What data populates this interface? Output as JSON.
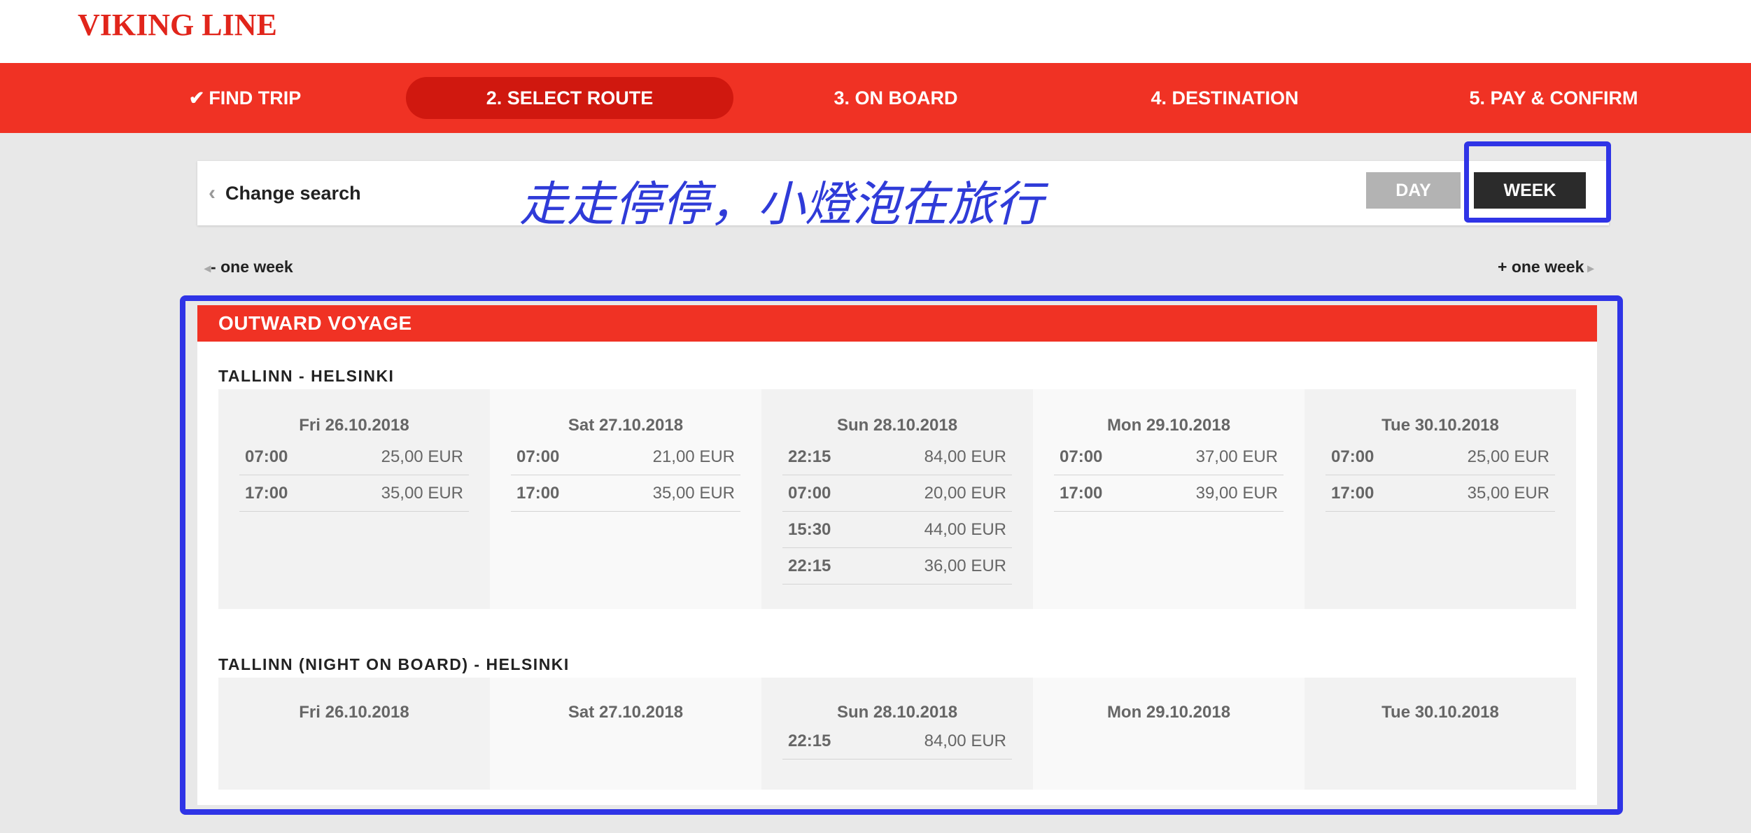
{
  "brand": {
    "logo": "VIKING LINE"
  },
  "steps": [
    {
      "label": "FIND TRIP",
      "icon": "check-icon"
    },
    {
      "label": "2. SELECT ROUTE"
    },
    {
      "label": "3. ON BOARD"
    },
    {
      "label": "4. DESTINATION"
    },
    {
      "label": "5. PAY & CONFIRM"
    }
  ],
  "search": {
    "change_label": "Change search",
    "day_label": "DAY",
    "week_label": "WEEK",
    "watermark": "走走停停，小燈泡在旅行"
  },
  "week_nav": {
    "prev": "- one week",
    "next": "+ one week"
  },
  "voyage": {
    "header": "OUTWARD VOYAGE",
    "routes": [
      {
        "title": "TALLINN - HELSINKI",
        "days": [
          {
            "date": "Fri 26.10.2018",
            "departures": [
              {
                "time": "07:00",
                "price": "25,00 EUR"
              },
              {
                "time": "17:00",
                "price": "35,00 EUR"
              }
            ]
          },
          {
            "date": "Sat 27.10.2018",
            "departures": [
              {
                "time": "07:00",
                "price": "21,00 EUR"
              },
              {
                "time": "17:00",
                "price": "35,00 EUR"
              }
            ]
          },
          {
            "date": "Sun 28.10.2018",
            "departures": [
              {
                "time": "22:15",
                "price": "84,00 EUR"
              },
              {
                "time": "07:00",
                "price": "20,00 EUR"
              },
              {
                "time": "15:30",
                "price": "44,00 EUR"
              },
              {
                "time": "22:15",
                "price": "36,00 EUR"
              }
            ]
          },
          {
            "date": "Mon 29.10.2018",
            "departures": [
              {
                "time": "07:00",
                "price": "37,00 EUR"
              },
              {
                "time": "17:00",
                "price": "39,00 EUR"
              }
            ]
          },
          {
            "date": "Tue 30.10.2018",
            "departures": [
              {
                "time": "07:00",
                "price": "25,00 EUR"
              },
              {
                "time": "17:00",
                "price": "35,00 EUR"
              }
            ]
          }
        ]
      },
      {
        "title": "TALLINN (NIGHT ON BOARD) - HELSINKI",
        "days": [
          {
            "date": "Fri 26.10.2018",
            "departures": []
          },
          {
            "date": "Sat 27.10.2018",
            "departures": []
          },
          {
            "date": "Sun 28.10.2018",
            "departures": [
              {
                "time": "22:15",
                "price": "84,00 EUR"
              }
            ]
          },
          {
            "date": "Mon 29.10.2018",
            "departures": []
          },
          {
            "date": "Tue 30.10.2018",
            "departures": []
          }
        ]
      }
    ]
  }
}
